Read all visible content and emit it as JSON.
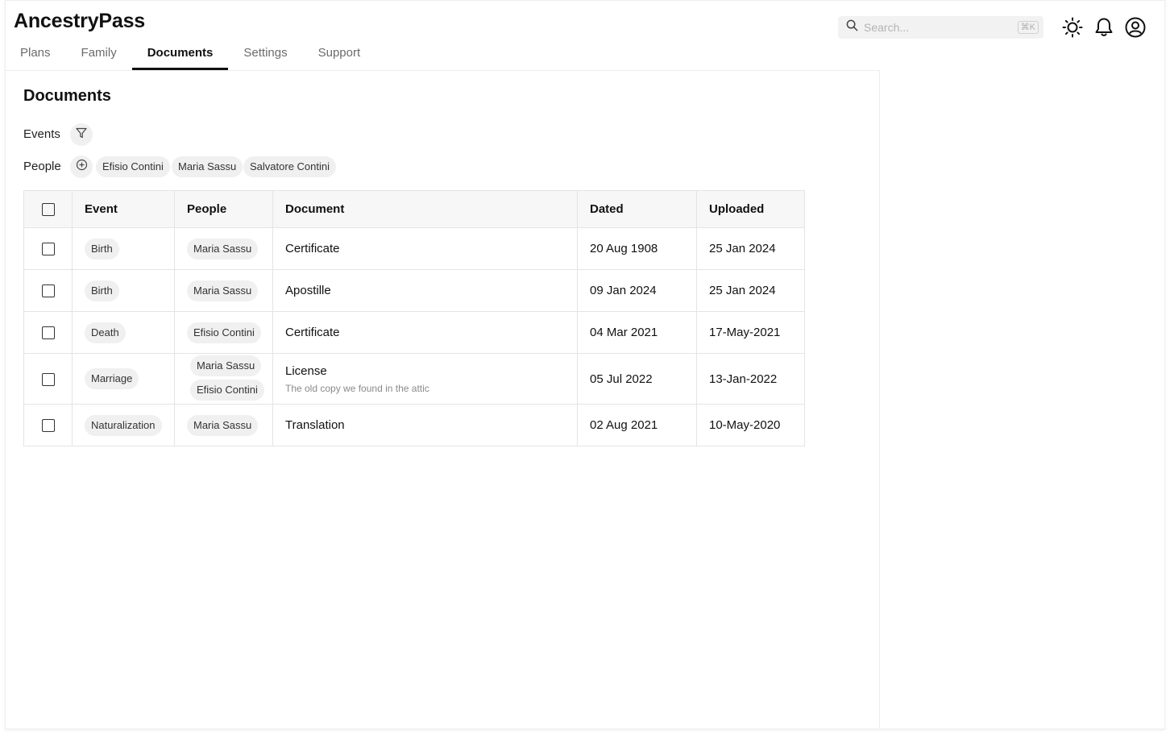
{
  "app": {
    "title": "AncestryPass"
  },
  "nav": {
    "tabs": [
      {
        "label": "Plans",
        "active": false
      },
      {
        "label": "Family",
        "active": false
      },
      {
        "label": "Documents",
        "active": true
      },
      {
        "label": "Settings",
        "active": false
      },
      {
        "label": "Support",
        "active": false
      }
    ]
  },
  "header": {
    "search": {
      "placeholder": "Search...",
      "shortcut": "⌘K",
      "icon": "search-icon"
    },
    "icons": [
      "theme-sun-icon",
      "notification-bell-icon",
      "user-account-icon"
    ]
  },
  "page": {
    "title": "Documents",
    "filters": {
      "events_label": "Events",
      "events_icon": "filter-funnel-icon",
      "people_label": "People",
      "people_icon": "add-circle-icon",
      "people_chips": [
        "Efisio Contini",
        "Maria Sassu",
        "Salvatore Contini"
      ]
    }
  },
  "table": {
    "headers": {
      "event": "Event",
      "people": "People",
      "document": "Document",
      "dated": "Dated",
      "uploaded": "Uploaded"
    },
    "rows": [
      {
        "event": "Birth",
        "people": [
          "Maria Sassu"
        ],
        "document": "Certificate",
        "note": "",
        "dated": "20 Aug 1908",
        "uploaded": "25 Jan 2024"
      },
      {
        "event": "Birth",
        "people": [
          "Maria Sassu"
        ],
        "document": "Apostille",
        "note": "",
        "dated": "09 Jan 2024",
        "uploaded": "25 Jan 2024"
      },
      {
        "event": "Death",
        "people": [
          "Efisio Contini"
        ],
        "document": "Certificate",
        "note": "",
        "dated": "04 Mar 2021",
        "uploaded": "17-May-2021"
      },
      {
        "event": "Marriage",
        "people": [
          "Maria Sassu",
          "Efisio Contini"
        ],
        "document": "License",
        "note": "The old copy we found in the attic",
        "dated": "05 Jul 2022",
        "uploaded": "13-Jan-2022"
      },
      {
        "event": "Naturalization",
        "people": [
          "Maria Sassu"
        ],
        "document": "Translation",
        "note": "",
        "dated": "02 Aug 2021",
        "uploaded": "10-May-2020"
      }
    ]
  }
}
